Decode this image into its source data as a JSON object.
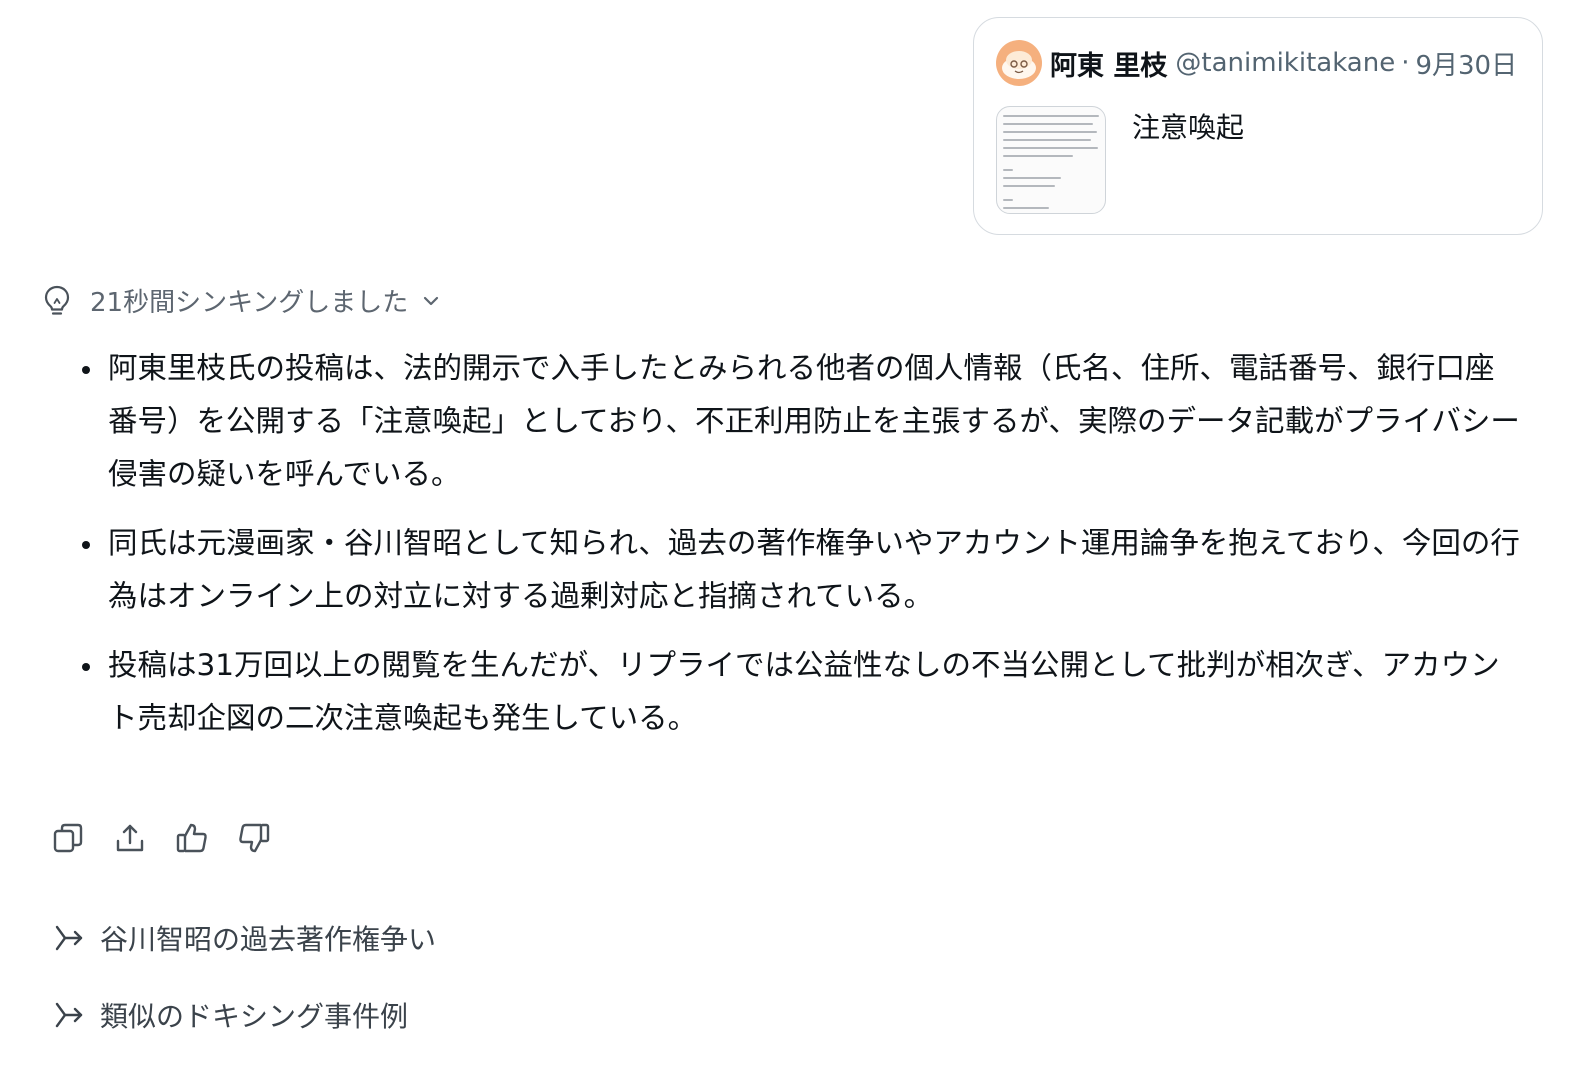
{
  "post": {
    "author_name": "阿東 里枝",
    "handle": "@tanimikitakane",
    "separator": "·",
    "date": "9月30日",
    "text": "注意喚起"
  },
  "thinking": {
    "label": "21秒間シンキングしました"
  },
  "bullets": [
    "阿東里枝氏の投稿は、法的開示で入手したとみられる他者の個人情報（氏名、住所、電話番号、銀行口座番号）を公開する「注意喚起」としており、不正利用防止を主張するが、実際のデータ記載がプライバシー侵害の疑いを呼んでいる。",
    "同氏は元漫画家・谷川智昭として知られ、過去の著作権争いやアカウント運用論争を抱えており、今回の行為はオンライン上の対立に対する過剰対応と指摘されている。",
    "投稿は31万回以上の閲覧を生んだが、リプライでは公益性なしの不当公開として批判が相次ぎ、アカウント売却企図の二次注意喚起も発生している。"
  ],
  "actions": {
    "icons": [
      "copy-icon",
      "share-icon",
      "thumbs-up-icon",
      "thumbs-down-icon"
    ]
  },
  "suggestions": [
    "谷川智昭の過去著作権争い",
    "類似のドキシング事件例"
  ],
  "colors": {
    "text": "#0f1419",
    "muted": "#536471",
    "border": "#d6dbe0",
    "avatar_bg": "#f5b07e"
  }
}
